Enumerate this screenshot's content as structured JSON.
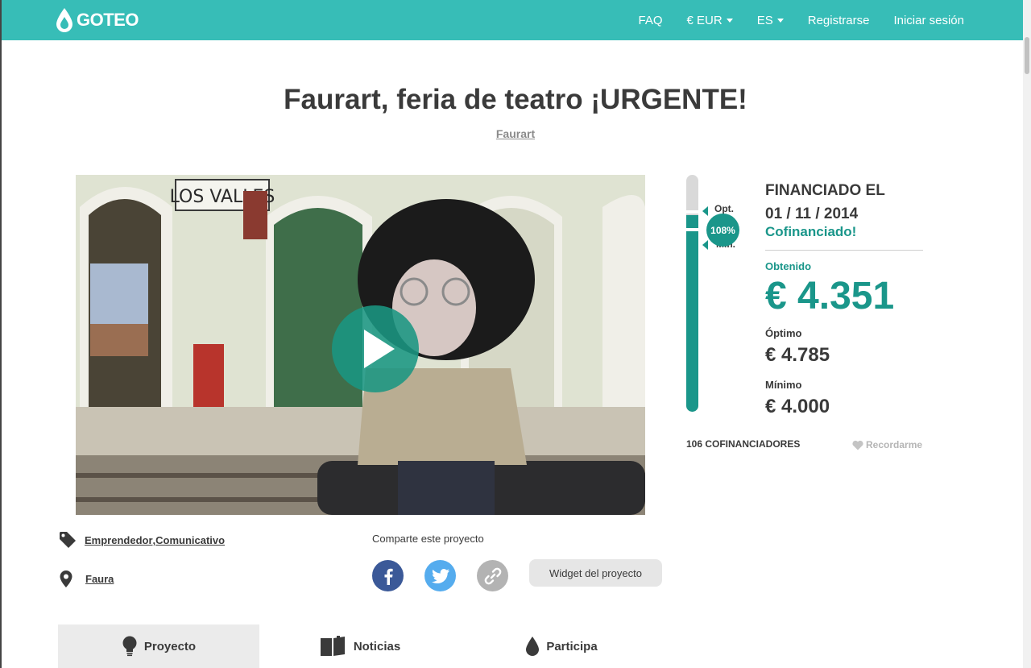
{
  "brand": {
    "name": "GOTEO",
    "color": "#37bdb7",
    "accent": "#1a968a"
  },
  "nav": {
    "faq": "FAQ",
    "currency": "€ EUR",
    "language": "ES",
    "register": "Registrarse",
    "login": "Iniciar sesión"
  },
  "project": {
    "title": "Faurart, feria de teatro ¡URGENTE!",
    "owner": "Faurart"
  },
  "video": {
    "station_sign": "LOS VALLES",
    "play_icon": "play-icon"
  },
  "funding": {
    "progress_percent": "108%",
    "progress_fraction": 1.08,
    "optimum_label": "Opt.",
    "minimum_label": "Min.",
    "funded_title_line1": "FINANCIADO EL",
    "funded_title_line2": "01 / 11 / 2014",
    "status": "Cofinanciado!",
    "obtained_label": "Obtenido",
    "obtained_value": "€ 4.351",
    "optimum_title": "Óptimo",
    "optimum_value": "€ 4.785",
    "minimum_title": "Mínimo",
    "minimum_value": "€ 4.000",
    "backers": "106 COFINANCIADORES",
    "remind": "Recordarme"
  },
  "meta": {
    "category_1": "Emprendedor",
    "category_sep": ", ",
    "category_2": "Comunicativo",
    "location": "Faura"
  },
  "share": {
    "title": "Comparte este proyecto",
    "widget": "Widget del proyecto",
    "facebook_color": "#3b5998",
    "twitter_color": "#55acee",
    "link_color": "#b3b3b3"
  },
  "tabs": [
    {
      "label": "Proyecto",
      "icon": "lightbulb-icon"
    },
    {
      "label": "Noticias",
      "icon": "book-icon"
    },
    {
      "label": "Participa",
      "icon": "drop-icon"
    }
  ]
}
